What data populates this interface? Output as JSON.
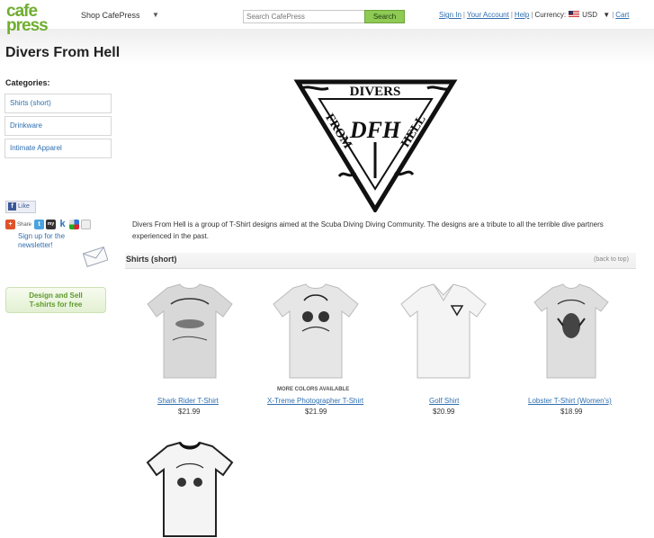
{
  "header": {
    "logo_line1": "cafe",
    "logo_line2": "press",
    "shop_label": "Shop CafePress",
    "search_placeholder": "Search CafePress",
    "search_button": "Search",
    "sign_in": "Sign In",
    "your_account": "Your Account",
    "help": "Help",
    "currency_label": "Currency:",
    "currency_value": "USD",
    "cart": "Cart"
  },
  "page": {
    "title": "Divers From Hell",
    "description": "Divers From Hell is a group of T-Shirt designs aimed at the Scuba Diving Diving Community. The designs are a tribute to all the terrible dive partners experienced in the past."
  },
  "sidebar": {
    "categories_heading": "Categories:",
    "categories": [
      {
        "label": "Shirts (short)"
      },
      {
        "label": "Drinkware"
      },
      {
        "label": "Intimate Apparel"
      }
    ],
    "like_label": "Like",
    "share_label": "Share",
    "newsletter": "Sign up for the newsletter!",
    "design_line1": "Design and Sell",
    "design_line2": "T-shirts for free"
  },
  "logo_art": {
    "top_text": "DIVERS",
    "left_text": "FROM",
    "right_text": "HELL",
    "center_text": "DFH"
  },
  "section": {
    "title": "Shirts (short)",
    "back_to_top": "(back to top)",
    "more_colors": "MORE COLORS AVAILABLE"
  },
  "products": [
    {
      "name": "Shark Rider T-Shirt",
      "price": "$21.99",
      "color": "#d8d8d8"
    },
    {
      "name": "X-Treme Photographer T-Shirt",
      "price": "$21.99",
      "color": "#e6e6e6"
    },
    {
      "name": "Golf Shirt",
      "price": "$20.99",
      "color": "#f4f4f4"
    },
    {
      "name": "Lobster T-Shirt (Women's)",
      "price": "$18.99",
      "color": "#dedede"
    },
    {
      "name": "",
      "price": "",
      "color": "#f4f4f4"
    }
  ],
  "colors": {
    "brand_green": "#6fae2f",
    "link_blue": "#2f6fb0",
    "search_button_green": "#8fcb54"
  },
  "icons": [
    "chevron-down-icon",
    "us-flag-icon",
    "facebook-icon",
    "share-icon",
    "twitter-icon",
    "myspace-icon",
    "k-icon",
    "delicious-icon",
    "email-icon",
    "envelope-icon"
  ]
}
